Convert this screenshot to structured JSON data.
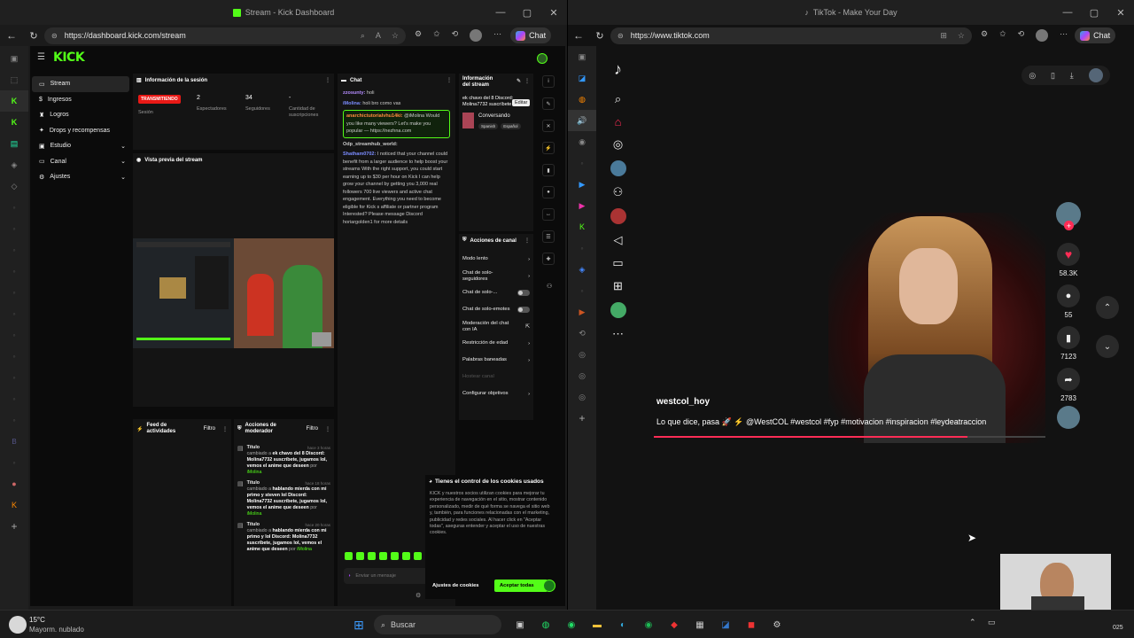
{
  "left_window": {
    "title": "Stream - Kick Dashboard",
    "url": "https://dashboard.kick.com/stream",
    "copilot_label": "Chat",
    "kick": {
      "nav": [
        {
          "label": "Stream"
        },
        {
          "label": "Ingresos"
        },
        {
          "label": "Logros"
        },
        {
          "label": "Drops y recompensas"
        },
        {
          "label": "Estudio"
        },
        {
          "label": "Canal"
        },
        {
          "label": "Ajustes"
        }
      ],
      "session": {
        "title": "Información de la sesión",
        "badge": "TRANSMITIENDO",
        "badge_label": "Sesión",
        "stats": [
          {
            "value": "2",
            "label": "Espectadores"
          },
          {
            "value": "34",
            "label": "Seguidores"
          },
          {
            "value": "-",
            "label": "Cantidad de suscripciones"
          }
        ]
      },
      "preview_title": "Vista previa del stream",
      "activity": {
        "title": "Feed de actividades",
        "filter": "Filtro"
      },
      "modactions": {
        "title": "Acciones de moderador",
        "filter": "Filtro",
        "items": [
          {
            "title": "Título",
            "time": "hace 3 horas",
            "prefix": "cambiado a",
            "text": "ek chavo del 8 Discord: Molina7732 suscríbete, jugamos lol, vemos el anime que deseen",
            "by": "por",
            "user": "iMolina"
          },
          {
            "title": "Título",
            "time": "hace 18 horas",
            "prefix": "cambiado a",
            "text": "hablando mierda con mi primo y steven lol Discord: Molina7732 suscríbete, jugamos lol, vemos el anime que deseen",
            "by": "por",
            "user": "iMolina"
          },
          {
            "title": "Título",
            "time": "hace 20 horas",
            "prefix": "cambiado a",
            "text": "hablando mierda con mi primo y lol Discord: Molina7732 suscríbete, jugamos lol, vemos el anime que deseen",
            "by": "por",
            "user": "iMolina"
          }
        ]
      },
      "chat": {
        "title": "Chat",
        "input_placeholder": "Enviar un mensaje",
        "messages": [
          {
            "user": "zzosunty:",
            "text": "holi",
            "color": "#b58cff"
          },
          {
            "user": "iMolina:",
            "text": "holi bro como vas",
            "color": "#7b8cff"
          },
          {
            "user": "anarchictutorialvhu14ki:",
            "text": "@iMolina Would you like many viewers? Let's make you popular — https://nezhna.com",
            "color": "#ff8a3d",
            "highlight": true
          },
          {
            "user": "Odp_streamhub_world:",
            "text": "",
            "color": "#cccccc"
          },
          {
            "user": "Shatham0702:",
            "text": "I noticed that your channel could benefit from a larger audience to help boost your streams With the right support, you could start earning up to $30 per hour on Kick I can help grow your channel by getting you 3,000 real followers 700 live viewers and active chat engagement. Everything you need to become eligible for Kick s affiliate or partner program Interested? Please message Discord horiargolden1 for more details",
            "color": "#7b8cff"
          }
        ]
      },
      "stream_info": {
        "title": "Información del stream",
        "edit_tooltip": "Editar",
        "stream_title": "ek chavo del 8 Discord: Molina7732 suscríbete",
        "category": "Conversando",
        "tags": [
          "Spanish",
          "Español"
        ]
      },
      "channel_actions": {
        "title": "Acciones de canal",
        "items": [
          {
            "label": "Modo lento",
            "kind": "arrow"
          },
          {
            "label": "Chat de solo-seguidores",
            "kind": "arrow"
          },
          {
            "label": "Chat de solo-...",
            "kind": "toggle"
          },
          {
            "label": "Chat de solo-emotes",
            "kind": "toggle"
          },
          {
            "label": "Moderación del chat con IA",
            "kind": "external"
          },
          {
            "label": "Restricción de edad",
            "kind": "arrow"
          },
          {
            "label": "Palabras baneadas",
            "kind": "arrow"
          },
          {
            "label": "Hostear canal",
            "kind": "disabled"
          },
          {
            "label": "Configurar objetivos",
            "kind": "arrow"
          }
        ]
      },
      "cookies": {
        "title": "Tienes el control de los cookies usados",
        "body": "KICK y nuestros socios utilizan cookies para mejorar tu experiencia de navegación en el sitio, mostrar contenido personalizado, medir de qué forma se navega el sitio web y, también, para funciones relacionadas con el marketing, publicidad y redes sociales. Al hacer click en \"Aceptar todas\", aseguras entender y aceptar el uso de nuestras cookies.",
        "settings_btn": "Ajustes de cookies",
        "accept_btn": "Aceptar todas"
      }
    }
  },
  "right_window": {
    "title": "TikTok - Make Your Day",
    "url": "https://www.tiktok.com",
    "copilot_label": "Chat",
    "video": {
      "username": "westcol_hoy",
      "caption": "Lo que dice, pasa 🚀 ⚡ @WestCOL #westcol #fyp #motivacion #inspiracion #leydeatraccion",
      "progress": 0.8,
      "likes": "58.3K",
      "comments": "55",
      "saves": "7123",
      "shares": "2783"
    }
  },
  "taskbar": {
    "temp": "15°C",
    "weather": "Mayorm. nublado",
    "search_placeholder": "Buscar",
    "year_fragment": "025"
  },
  "colors": {
    "kick_green": "#53fc18",
    "tiktok_red": "#fe2c55",
    "live_red": "#e91916"
  }
}
